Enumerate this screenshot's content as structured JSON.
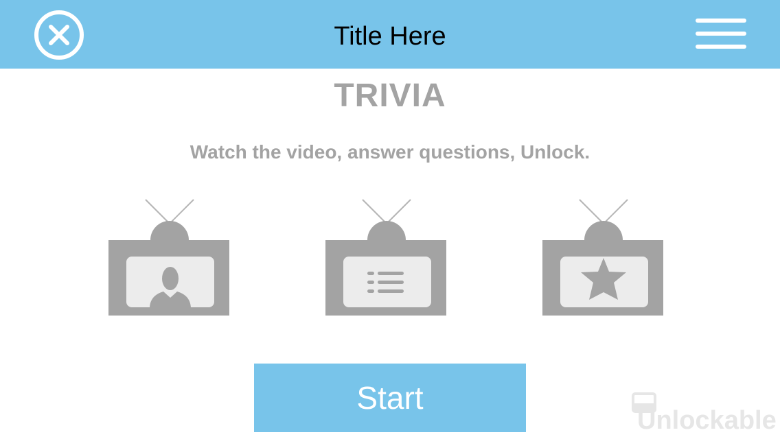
{
  "header": {
    "title": "Title Here",
    "close_icon": "close-circle-icon",
    "menu_icon": "hamburger-menu-icon"
  },
  "main": {
    "heading": "TRIVIA",
    "subtitle": "Watch the video, answer questions, Unlock.",
    "steps": [
      {
        "icon": "tv-person-icon"
      },
      {
        "icon": "tv-list-icon"
      },
      {
        "icon": "tv-star-icon"
      }
    ],
    "start_label": "Start"
  },
  "brand": {
    "name": "Unlockable",
    "icon": "padlock-icon"
  },
  "colors": {
    "accent": "#78c4ea",
    "muted_text": "#a3a3a3",
    "tv_body": "#a3a3a3",
    "tv_screen": "#ececec",
    "watermark": "#e6e6e6"
  }
}
